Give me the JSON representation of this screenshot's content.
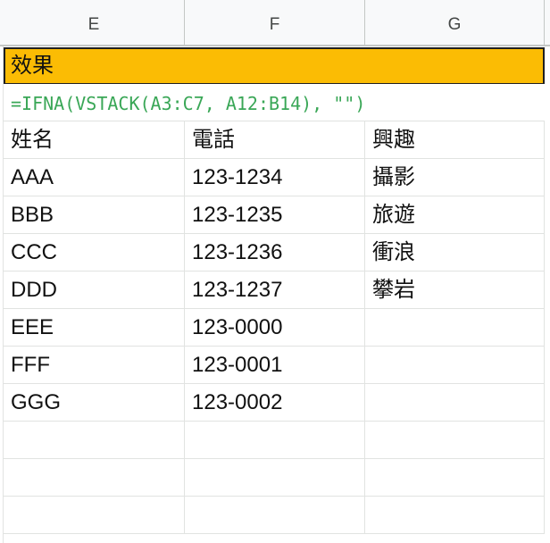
{
  "columns": [
    "E",
    "F",
    "G"
  ],
  "merged_header": {
    "label": "效果",
    "fill_color": "#fbbc04"
  },
  "formula": {
    "text": "=IFNA(VSTACK(A3:C7, A12:B14), \"\")",
    "color": "#3aa757"
  },
  "table": {
    "headers": [
      "姓名",
      "電話",
      "興趣"
    ],
    "rows": [
      [
        "AAA",
        "123-1234",
        "攝影"
      ],
      [
        "BBB",
        "123-1235",
        "旅遊"
      ],
      [
        "CCC",
        "123-1236",
        "衝浪"
      ],
      [
        "DDD",
        "123-1237",
        "攀岩"
      ],
      [
        "EEE",
        "123-0000",
        ""
      ],
      [
        "FFF",
        "123-0001",
        ""
      ],
      [
        "GGG",
        "123-0002",
        ""
      ]
    ]
  },
  "empty_rows": 3
}
